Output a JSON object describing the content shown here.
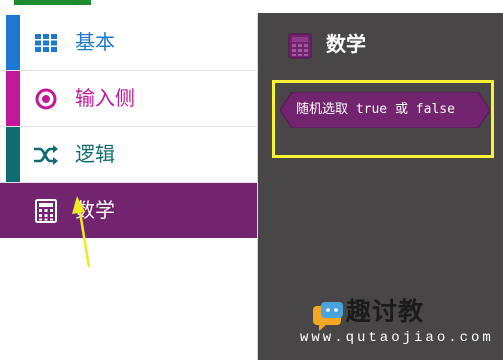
{
  "colors": {
    "basic": "#1e78d2",
    "input": "#c2189a",
    "logic": "#0f6c70",
    "math": "#73246f",
    "workspace": "#494648",
    "highlight": "#f7f234"
  },
  "sidebar": {
    "categories": [
      {
        "label": "基本",
        "icon": "grid-icon"
      },
      {
        "label": "输入侧",
        "icon": "target-icon"
      },
      {
        "label": "逻辑",
        "icon": "shuffle-icon"
      },
      {
        "label": "数学",
        "icon": "calculator-icon",
        "selected": true
      }
    ]
  },
  "flyout": {
    "title": "数学",
    "icon": "calculator-icon",
    "block": {
      "label": "随机选取 true 或 false"
    }
  },
  "watermark": {
    "brand": "趣讨教",
    "url": "www.qutaojiao.com"
  }
}
